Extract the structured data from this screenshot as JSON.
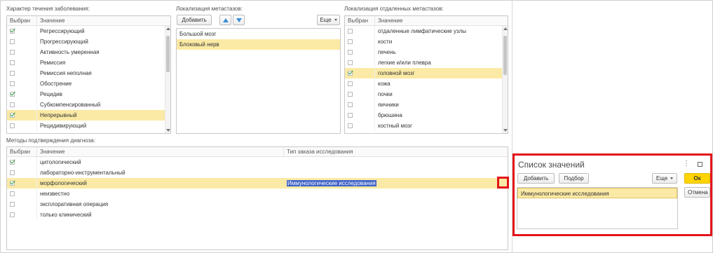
{
  "character_panel": {
    "label": "Характер течения заболевания:",
    "col_selected": "Выбран",
    "col_value": "Значение",
    "rows": [
      {
        "checked": true,
        "value": "Регрессирующий"
      },
      {
        "checked": false,
        "value": "Прогрессирующий"
      },
      {
        "checked": false,
        "value": "Активность умеренная"
      },
      {
        "checked": false,
        "value": "Ремиссия"
      },
      {
        "checked": false,
        "value": "Ремиссия неполная"
      },
      {
        "checked": false,
        "value": "Обострение"
      },
      {
        "checked": true,
        "value": "Рецидив"
      },
      {
        "checked": false,
        "value": "Субкомпенсированный"
      },
      {
        "checked": true,
        "value": "Непрерывный",
        "selected": true
      },
      {
        "checked": false,
        "value": "Рецидивирующий"
      }
    ]
  },
  "metastasis_panel": {
    "label": "Локализация метастазов:",
    "add_label": "Добавить",
    "more_label": "Еще",
    "items": [
      {
        "value": "Большой мозг"
      },
      {
        "value": "Блоковый нерв",
        "selected": true
      }
    ]
  },
  "distant_panel": {
    "label": "Локализация отдаленных метастазов:",
    "col_selected": "Выбран",
    "col_value": "Значение",
    "rows": [
      {
        "checked": false,
        "value": "отдаленные лимфатические узлы"
      },
      {
        "checked": false,
        "value": "кости"
      },
      {
        "checked": false,
        "value": "печень"
      },
      {
        "checked": false,
        "value": "легкие и/или плевра"
      },
      {
        "checked": true,
        "value": "головной мозг",
        "selected": true
      },
      {
        "checked": false,
        "value": "кожа"
      },
      {
        "checked": false,
        "value": "почки"
      },
      {
        "checked": false,
        "value": "яичники"
      },
      {
        "checked": false,
        "value": "брюшина"
      },
      {
        "checked": false,
        "value": "костный мозг"
      }
    ]
  },
  "methods_panel": {
    "label": "Методы подтверждения диагноза:",
    "col_selected": "Выбран",
    "col_value": "Значение",
    "col_order_type": "Тип заказа исследования",
    "rows": [
      {
        "checked": true,
        "value": "цитологический",
        "order_type": ""
      },
      {
        "checked": false,
        "value": "лабораторно-инструментальный",
        "order_type": ""
      },
      {
        "checked": true,
        "value": "морфологический",
        "order_type": "Иммунологические исследования",
        "selected": true
      },
      {
        "checked": false,
        "value": "неизвестно",
        "order_type": ""
      },
      {
        "checked": false,
        "value": "эксплоративная операция",
        "order_type": ""
      },
      {
        "checked": false,
        "value": "только клинический",
        "order_type": ""
      }
    ]
  },
  "value_list_dialog": {
    "title": "Список значений",
    "add_label": "Добавить",
    "pick_label": "Подбор",
    "more_label": "Еще",
    "ok_label": "Ок",
    "cancel_label": "Отмена",
    "items": [
      {
        "value": "Иммунологические исследования",
        "selected": true
      }
    ]
  },
  "colors": {
    "selection_row": "#fbeaa5",
    "highlight_red": "#e3141a",
    "ok_button": "#ffd400",
    "checkmark": "#2e9a3e",
    "text_selection": "#3f61c7"
  }
}
